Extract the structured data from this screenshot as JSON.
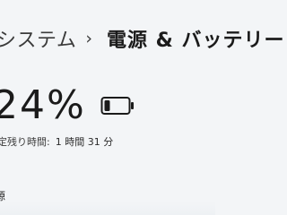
{
  "breadcrumb": {
    "parent": "システム",
    "separator": "›",
    "current": "電源 & バッテリー"
  },
  "battery": {
    "percent_label": "24%",
    "percent_value": 0.24,
    "icon": "battery-low-icon",
    "fill_color": "#1b1b1b"
  },
  "remaining": {
    "label": "定残り時間:",
    "value": "1 時間 31 分"
  },
  "section": {
    "heading": "源"
  }
}
